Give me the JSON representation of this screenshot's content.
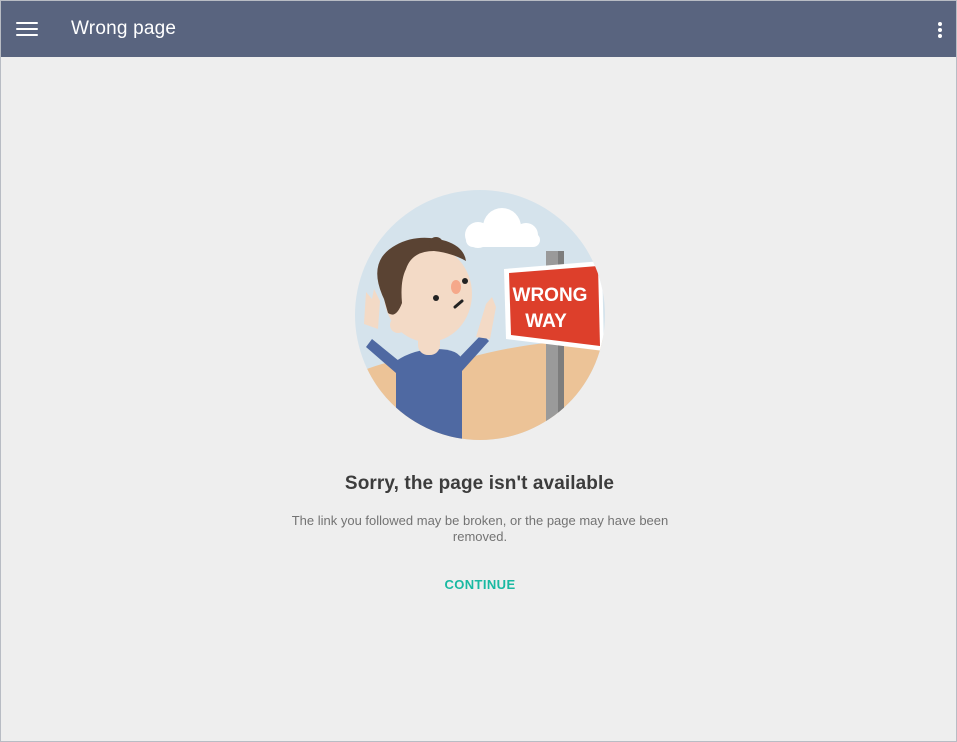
{
  "app_bar": {
    "title": "Wrong page",
    "menu_icon": "hamburger-menu-icon",
    "overflow_icon": "more-vert-icon",
    "background_color": "#59647f"
  },
  "error": {
    "sign_line1": "WRONG",
    "sign_line2": "WAY",
    "heading": "Sorry, the page isn't available",
    "message": "The link you followed may be broken, or the page may have been removed.",
    "continue_label": "CONTINUE",
    "accent_color": "#19b9a2"
  }
}
